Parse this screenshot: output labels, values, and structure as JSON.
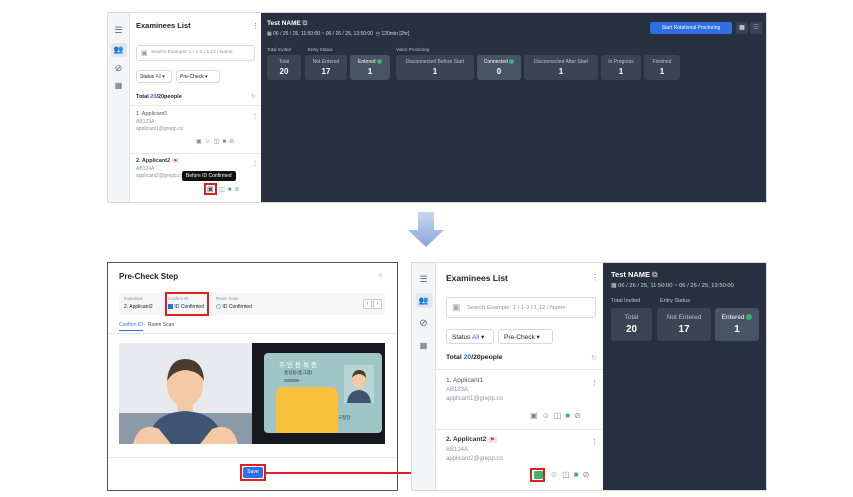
{
  "panel": {
    "title": "Examinees List",
    "search_placeholder": "Search Example: 1 / 1-3 / 1,12 / Name",
    "status_label": "Status",
    "status_value": "All",
    "precheck_label": "Pre-Check",
    "total_prefix": "Total ",
    "total_count": "20",
    "total_suffix": "/20people",
    "applicants": [
      {
        "name": "1. Applicant1",
        "code": "AB123A",
        "email": "applicant1@grepp.co"
      },
      {
        "name": "2. Applicant2",
        "code": "AB124A",
        "email": "applicant2@grepp.co"
      }
    ],
    "tooltip": "Before ID Confirmed"
  },
  "test": {
    "name": "Test NAME",
    "schedule": "06 / 26 / 25, 11:50:00 ~ 06 / 26 / 25, 13:50:00",
    "duration": "120min [2hr]",
    "proctor_button": "Start Rotational Proctoring",
    "total_invited_label": "Total Invited",
    "entry_status_label": "Entry Status",
    "video_proctoring_label": "Video Proctoring",
    "stats": [
      {
        "label": "Total",
        "value": "20"
      },
      {
        "label": "Not Entered",
        "value": "17"
      },
      {
        "label": "Entered",
        "value": "1"
      },
      {
        "label": "Disconnected Before Start",
        "value": "1"
      },
      {
        "label": "Connected",
        "value": "0"
      },
      {
        "label": "Disconnected After Start",
        "value": "1"
      },
      {
        "label": "In Progress",
        "value": "1"
      },
      {
        "label": "Finished",
        "value": "1"
      }
    ]
  },
  "modal": {
    "title": "Pre-Check Step",
    "examinee_label": "Examinee",
    "examinee_value": "2. Applicant2",
    "confirm_id_label": "Confirm ID",
    "confirm_id_value": "ID Confirmed",
    "room_scan_label": "Room Scan",
    "room_scan_value": "ID Confirmed",
    "tab_confirm_id": "Confirm ID",
    "tab_room_scan": "Room Scan",
    "id_card_title": "주민등록증",
    "id_card_name": "홍길동(홍그렙)",
    "id_card_number": "000000 -",
    "id_card_stamp": "구청장",
    "save_button": "Save"
  },
  "colors": {
    "dark_bg": "#28313f",
    "accent": "#2f6fe4",
    "highlight": "#e02020",
    "green": "#3cb371"
  }
}
